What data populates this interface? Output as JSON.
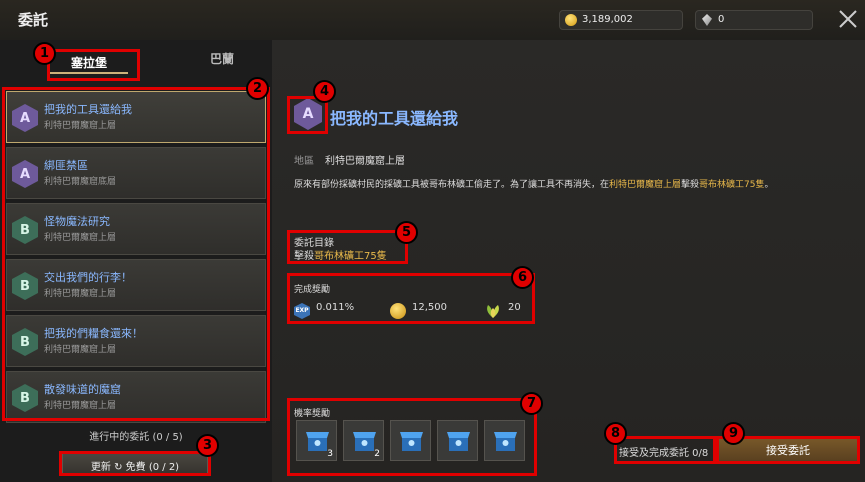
{
  "header": {
    "title": "委託",
    "gold_value": "3,189,002",
    "gem_value": "0"
  },
  "tabs": [
    {
      "label": "塞拉堡"
    },
    {
      "label": "巴蘭"
    }
  ],
  "quest_list": [
    {
      "grade": "A",
      "name": "把我的工具還給我",
      "location": "利特巴爾魔窟上層"
    },
    {
      "grade": "A",
      "name": "綁匪禁區",
      "location": "利特巴爾魔窟底層"
    },
    {
      "grade": "B",
      "name": "怪物魔法研究",
      "location": "利特巴爾魔窟上層"
    },
    {
      "grade": "B",
      "name": "交出我們的行李！",
      "location": "利特巴爾魔窟上層"
    },
    {
      "grade": "B",
      "name": "把我的們糧食還來！",
      "location": "利特巴爾魔窟上層"
    },
    {
      "grade": "B",
      "name": "散發味道的魔窟",
      "location": "利特巴爾魔窟上層"
    }
  ],
  "progress": {
    "text": "進行中的委託 (0 / 5)",
    "refresh_label": "更新",
    "free_label": "免費 (0 / 2)"
  },
  "detail": {
    "grade": "A",
    "title": "把我的工具還給我",
    "location_label": "地區",
    "location_value": "利特巴爾魔窟上層",
    "desc_prefix": "原來有部份採礦村民的採礦工具被哥布林礦工偷走了。為了讓工具不再消失，在",
    "desc_place": "利特巴爾魔窟上層",
    "desc_mid": "擊殺",
    "desc_target": "哥布林礦工75隻",
    "desc_suffix": "。",
    "objective_label": "委託目錄",
    "objective_prefix": "擊殺",
    "objective_target": "哥布林礦工75隻",
    "reward_label": "完成獎勵",
    "exp_icon_text": "EXP",
    "exp_value": "0.011%",
    "gold_reward": "12,500",
    "leaf_reward": "20",
    "chance_label": "機率獎勵",
    "chance_items": [
      {
        "icon": "blue-box-icon",
        "qty": "3"
      },
      {
        "icon": "blue-box-icon",
        "qty": "2"
      },
      {
        "icon": "blue-box-icon",
        "qty": ""
      },
      {
        "icon": "blue-box-icon",
        "qty": ""
      },
      {
        "icon": "blue-box-icon",
        "qty": ""
      }
    ]
  },
  "footer": {
    "accepted_text": "接受及完成委託 0/8",
    "accept_label": "接受委託"
  },
  "annotations": [
    "1",
    "2",
    "3",
    "4",
    "5",
    "6",
    "7",
    "8",
    "9"
  ],
  "colors": {
    "annotation": "#e00000",
    "highlight": "#e8b84a",
    "quest_name": "#8ab8ff"
  }
}
